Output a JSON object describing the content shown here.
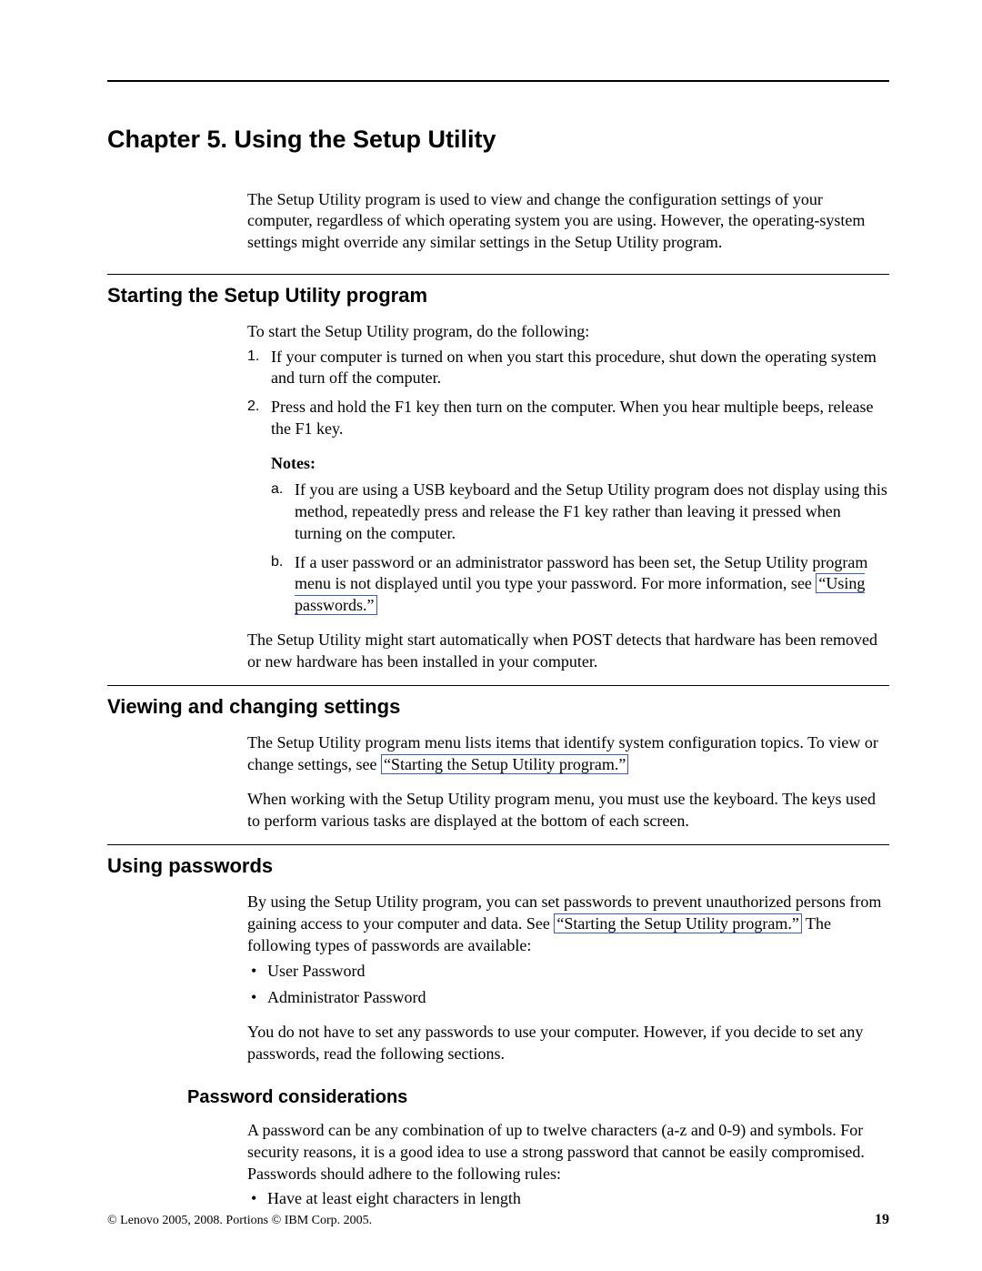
{
  "chapter_title": "Chapter 5. Using the Setup Utility",
  "intro": "The Setup Utility program is used to view and change the configuration settings of your computer, regardless of which operating system you are using. However, the operating-system settings might override any similar settings in the Setup Utility program.",
  "section_start": {
    "heading": "Starting the Setup Utility program",
    "lead": "To start the Setup Utility program, do the following:",
    "steps": [
      "If your computer is turned on when you start this procedure, shut down the operating system and turn off the computer.",
      "Press and hold the F1 key then turn on the computer. When you hear multiple beeps, release the F1 key."
    ],
    "notes_label": "Notes:",
    "notes": {
      "a": "If you are using a USB keyboard and the Setup Utility program does not display using this method, repeatedly press and release the F1 key rather than leaving it pressed when turning on the computer.",
      "b_before": "If a user password or an administrator password has been set, the Setup Utility program menu is not displayed until you type your password. For more information, see ",
      "b_link": "“Using passwords.”"
    },
    "tail": "The Setup Utility might start automatically when POST detects that hardware has been removed or new hardware has been installed in your computer."
  },
  "section_view": {
    "heading": "Viewing and changing settings",
    "p1_before": "The Setup Utility program menu lists items that identify system configuration topics. To view or change settings, see ",
    "p1_link": "“Starting the Setup Utility program.”",
    "p2": "When working with the Setup Utility program menu, you must use the keyboard. The keys used to perform various tasks are displayed at the bottom of each screen."
  },
  "section_pw": {
    "heading": "Using passwords",
    "p1_before": "By using the Setup Utility program, you can set passwords to prevent unauthorized persons from gaining access to your computer and data. See ",
    "p1_link": "“Starting the Setup Utility program.”",
    "p1_after": " The following types of passwords are available:",
    "bullets": [
      "User Password",
      "Administrator Password"
    ],
    "p2": "You do not have to set any passwords to use your computer. However, if you decide to set any passwords, read the following sections."
  },
  "subsection_pwc": {
    "heading": "Password considerations",
    "p1": "A password can be any combination of up to twelve characters (a-z and 0-9) and symbols. For security reasons, it is a good idea to use a strong password that cannot be easily compromised. Passwords should adhere to the following rules:",
    "bullets": [
      "Have at least eight characters in length"
    ]
  },
  "markers": {
    "num1": "1.",
    "num2": "2.",
    "letA": "a.",
    "letB": "b."
  },
  "footer": {
    "copyright": "© Lenovo 2005, 2008. Portions © IBM Corp. 2005.",
    "page": "19"
  }
}
